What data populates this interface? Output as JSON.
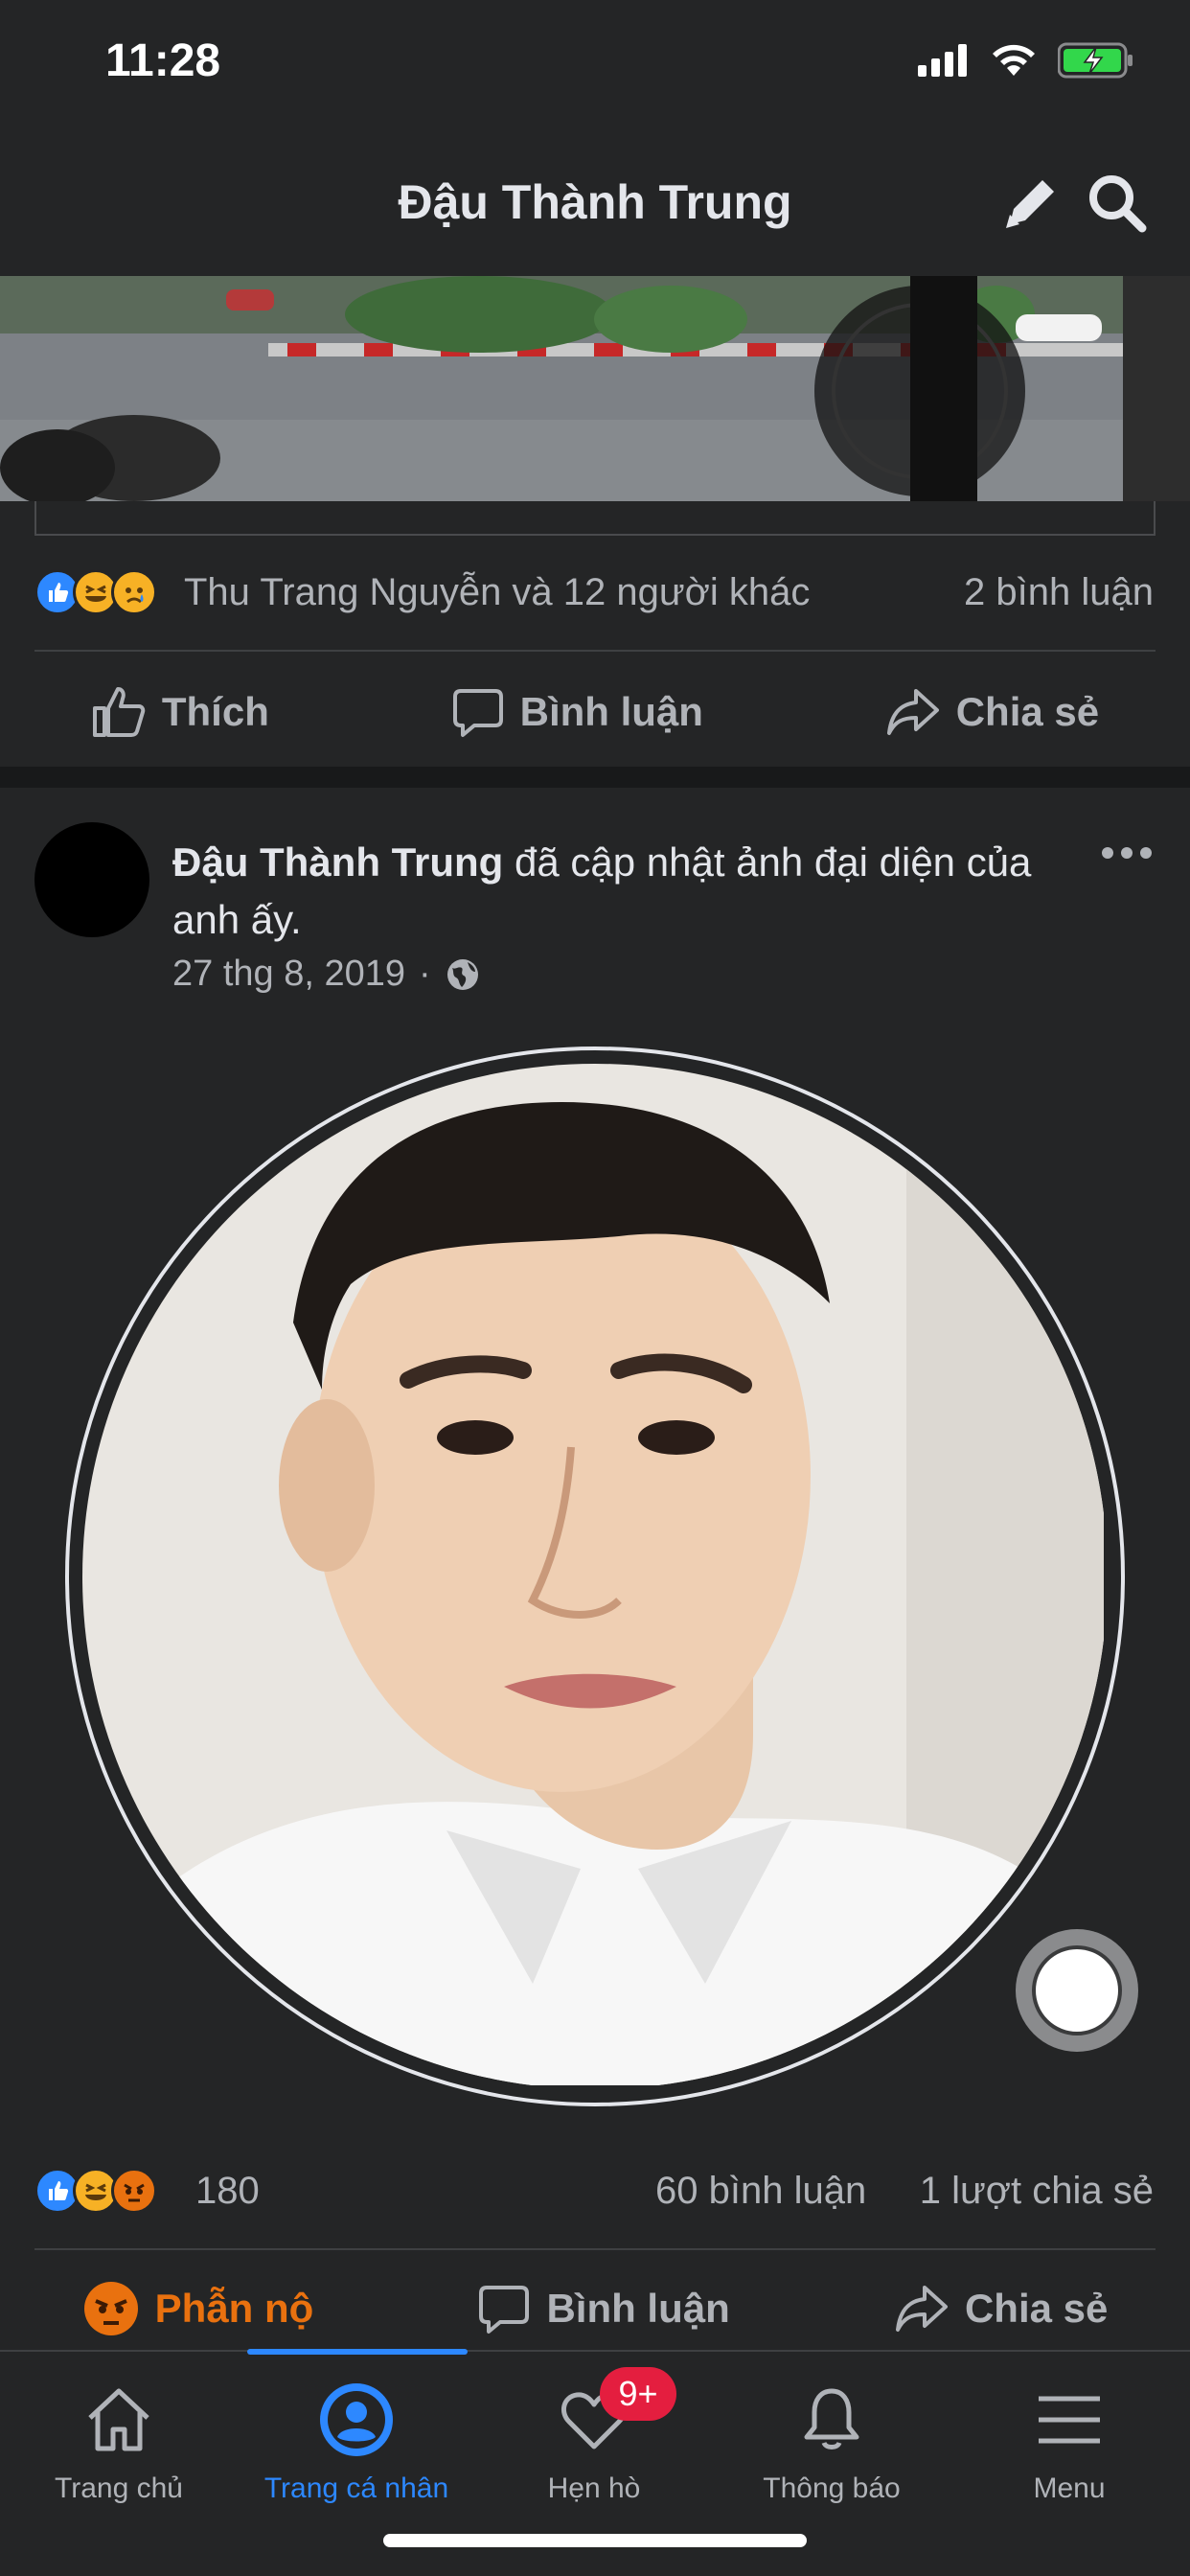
{
  "status_bar": {
    "time": "11:28"
  },
  "header": {
    "title": "Đậu Thành Trung"
  },
  "post1": {
    "reactions_summary": "Thu Trang Nguyễn và 12 người khác",
    "comments": "2 bình luận",
    "actions": {
      "like": "Thích",
      "comment": "Bình luận",
      "share": "Chia sẻ"
    }
  },
  "post2": {
    "author": "Đậu Thành Trung",
    "headline_rest": " đã cập nhật ảnh đại diện của anh ấy.",
    "date": "27 thg 8, 2019",
    "date_separator": "·",
    "reaction_count": "180",
    "comments": "60 bình luận",
    "shares": "1 lượt chia sẻ",
    "actions": {
      "reacted": "Phẫn nộ",
      "comment": "Bình luận",
      "share": "Chia sẻ"
    }
  },
  "bottom_nav": {
    "items": [
      {
        "label": "Trang chủ",
        "icon": "home-icon"
      },
      {
        "label": "Trang cá nhân",
        "icon": "profile-icon",
        "active": true
      },
      {
        "label": "Hẹn hò",
        "icon": "heart-icon",
        "badge": "9+"
      },
      {
        "label": "Thông báo",
        "icon": "bell-icon"
      },
      {
        "label": "Menu",
        "icon": "menu-icon"
      }
    ]
  },
  "colors": {
    "background": "#242526",
    "accent": "#2d88ff",
    "angry": "#e9710f",
    "badge": "#e41e3f"
  }
}
